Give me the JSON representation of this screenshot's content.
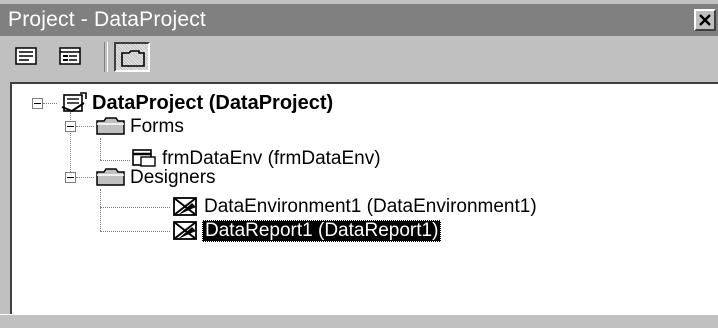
{
  "window": {
    "title": "Project - DataProject"
  },
  "toolbar": {
    "buttons": [
      {
        "name": "view-code",
        "icon": "view-code-icon"
      },
      {
        "name": "view-object",
        "icon": "view-object-icon"
      },
      {
        "name": "toggle-folders",
        "icon": "toggle-folders-icon",
        "pressed": true
      }
    ]
  },
  "tree": {
    "project": {
      "label": "DataProject (DataProject)",
      "icon": "project-icon",
      "expanded": true
    },
    "forms": {
      "label": "Forms",
      "icon": "folder-icon",
      "expanded": true
    },
    "form_item": {
      "label": "frmDataEnv (frmDataEnv)",
      "icon": "form-icon"
    },
    "designers": {
      "label": "Designers",
      "icon": "folder-icon",
      "expanded": true
    },
    "designer_items": [
      {
        "label": "DataEnvironment1 (DataEnvironment1)",
        "icon": "designer-icon",
        "selected": false
      },
      {
        "label": "DataReport1 (DataReport1)",
        "icon": "designer-icon",
        "selected": true
      }
    ]
  },
  "colors": {
    "titlebar": "#808080",
    "chrome": "#c0c0c0",
    "selection": "#000000"
  }
}
